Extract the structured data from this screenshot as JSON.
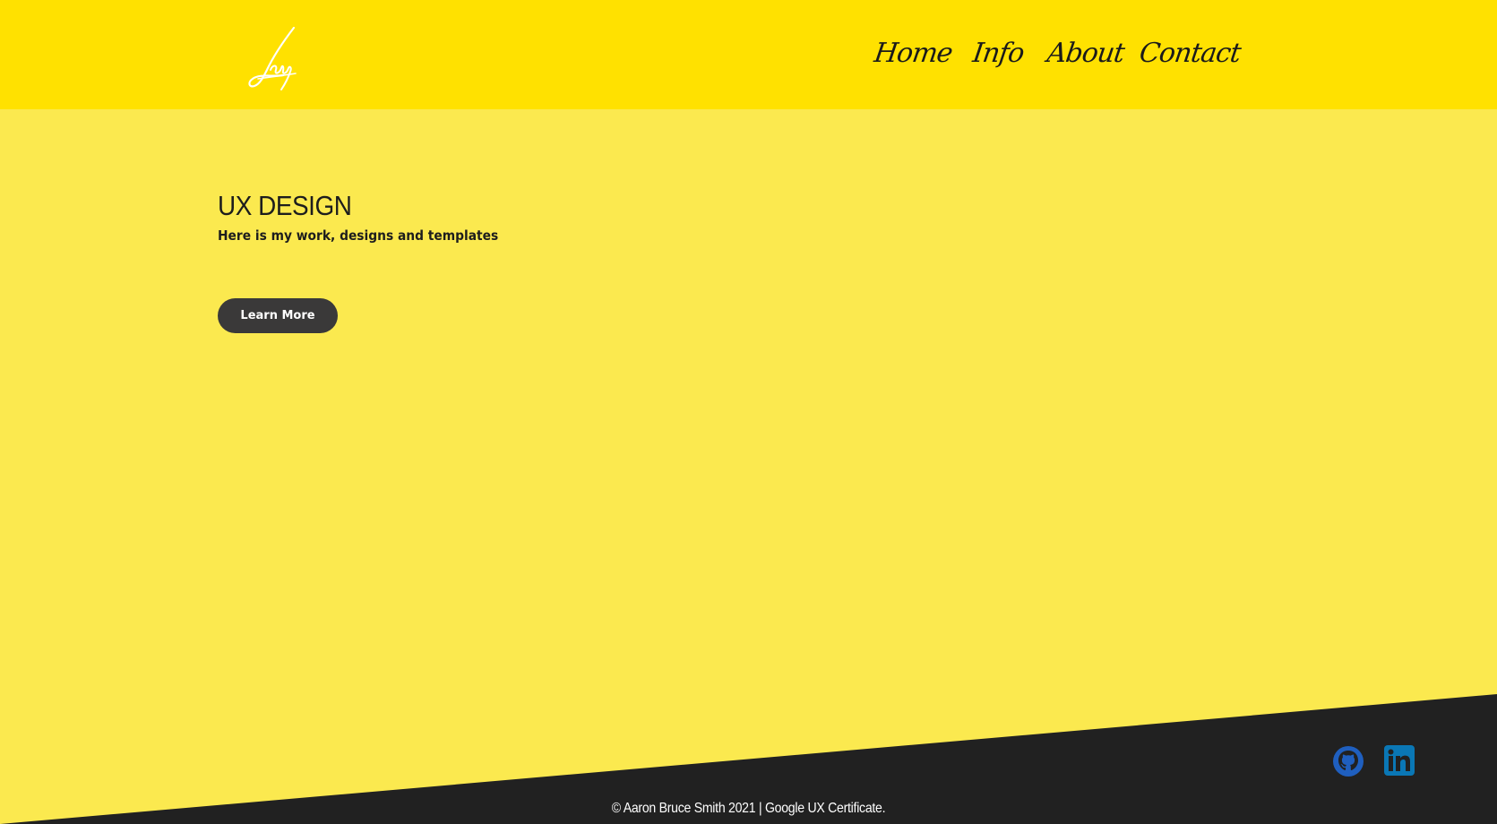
{
  "header": {
    "logo_text": "Lay",
    "nav": [
      {
        "label": "Home"
      },
      {
        "label": "Info"
      },
      {
        "label": "About"
      },
      {
        "label": "Contact"
      }
    ]
  },
  "hero": {
    "title": "UX DESIGN",
    "subtitle": "Here is my work, designs and templates",
    "button_label": "Learn More"
  },
  "footer": {
    "copyright": "© Aaron Bruce Smith 2021 |  Google UX Certificate.",
    "social": [
      {
        "icon": "github-icon"
      },
      {
        "icon": "linkedin-icon"
      }
    ]
  },
  "colors": {
    "header_bg": "#ffe100",
    "page_bg": "#fbe94f",
    "footer_bg": "#212121",
    "button_bg": "#3a3939",
    "github_blue": "#1f5fbf",
    "linkedin_blue": "#0a77b5"
  }
}
